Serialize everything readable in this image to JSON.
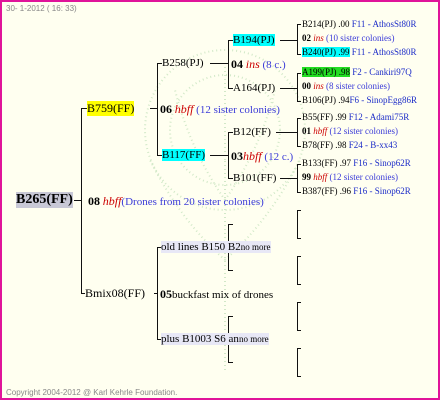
{
  "header": "30-  1-2012 ( 16: 33)",
  "footer": "Copyright 2004-2012 @ Karl Kehrle Foundation.",
  "root": {
    "id": "B265(FF)",
    "gen": "08",
    "code": "hbff",
    "note": "(Drones from 20 sister colonies)"
  },
  "left_upper": {
    "id": "B759(FF)",
    "gen": "06",
    "code": "hbff",
    "note": "(12 sister colonies)"
  },
  "left_lower": {
    "id": "Bmix08(FF)",
    "gen": "05",
    "text": "buckfast mix of drones"
  },
  "nodes": {
    "b258": "B258(PJ)",
    "b117": "B117(FF)",
    "b194": "B194(PJ)",
    "a164": "A164(PJ)",
    "b12": "B12(FF)",
    "b101": "B101(FF)",
    "b194_gen": "04",
    "b194_code": "ins",
    "b194_note": "(8 c.)",
    "b117_gen": "03",
    "b117_code": "hbff",
    "b117_note": "(12 c.)",
    "old_lines": "old lines B150 B2",
    "old_lines_more": "no more",
    "plus_lines": "plus B1003 S6 an",
    "plus_lines_more": "no more"
  },
  "right_col": [
    {
      "id": "B214(PJ)",
      "num": ".00",
      "tag": "F11",
      "name": "- AthosSt80R"
    },
    {
      "gen": "02",
      "code": "ins",
      "note": "(10 sister colonies)"
    },
    {
      "id": "B240(PJ)",
      "num": ".99",
      "tag": "F11",
      "name": "- AthosSt80R"
    },
    {
      "id": "A199(PJ)",
      "num": ".98",
      "tag": "F2",
      "name": "- Cankiri97Q"
    },
    {
      "gen": "00",
      "code": "ins",
      "note": "(8 sister colonies)"
    },
    {
      "id": "B106(PJ)",
      "num": ".94",
      "tag": "F6",
      "name": "- SinopEgg86R"
    },
    {
      "id": "B55(FF)",
      "num": ".99",
      "tag": "F12",
      "name": "- Adami75R"
    },
    {
      "gen": "01",
      "code": "hbff",
      "note": "(12 sister colonies)"
    },
    {
      "id": "B78(FF)",
      "num": ".98",
      "tag": "F24",
      "name": "- B-xx43"
    },
    {
      "id": "B133(FF)",
      "num": ".97",
      "tag": "F16",
      "name": "- Sinop62R"
    },
    {
      "gen": "99",
      "code": "hbff",
      "note": "(12 sister colonies)"
    },
    {
      "id": "B387(FF)",
      "num": ".96",
      "tag": "F16",
      "name": "- Sinop62R"
    }
  ]
}
